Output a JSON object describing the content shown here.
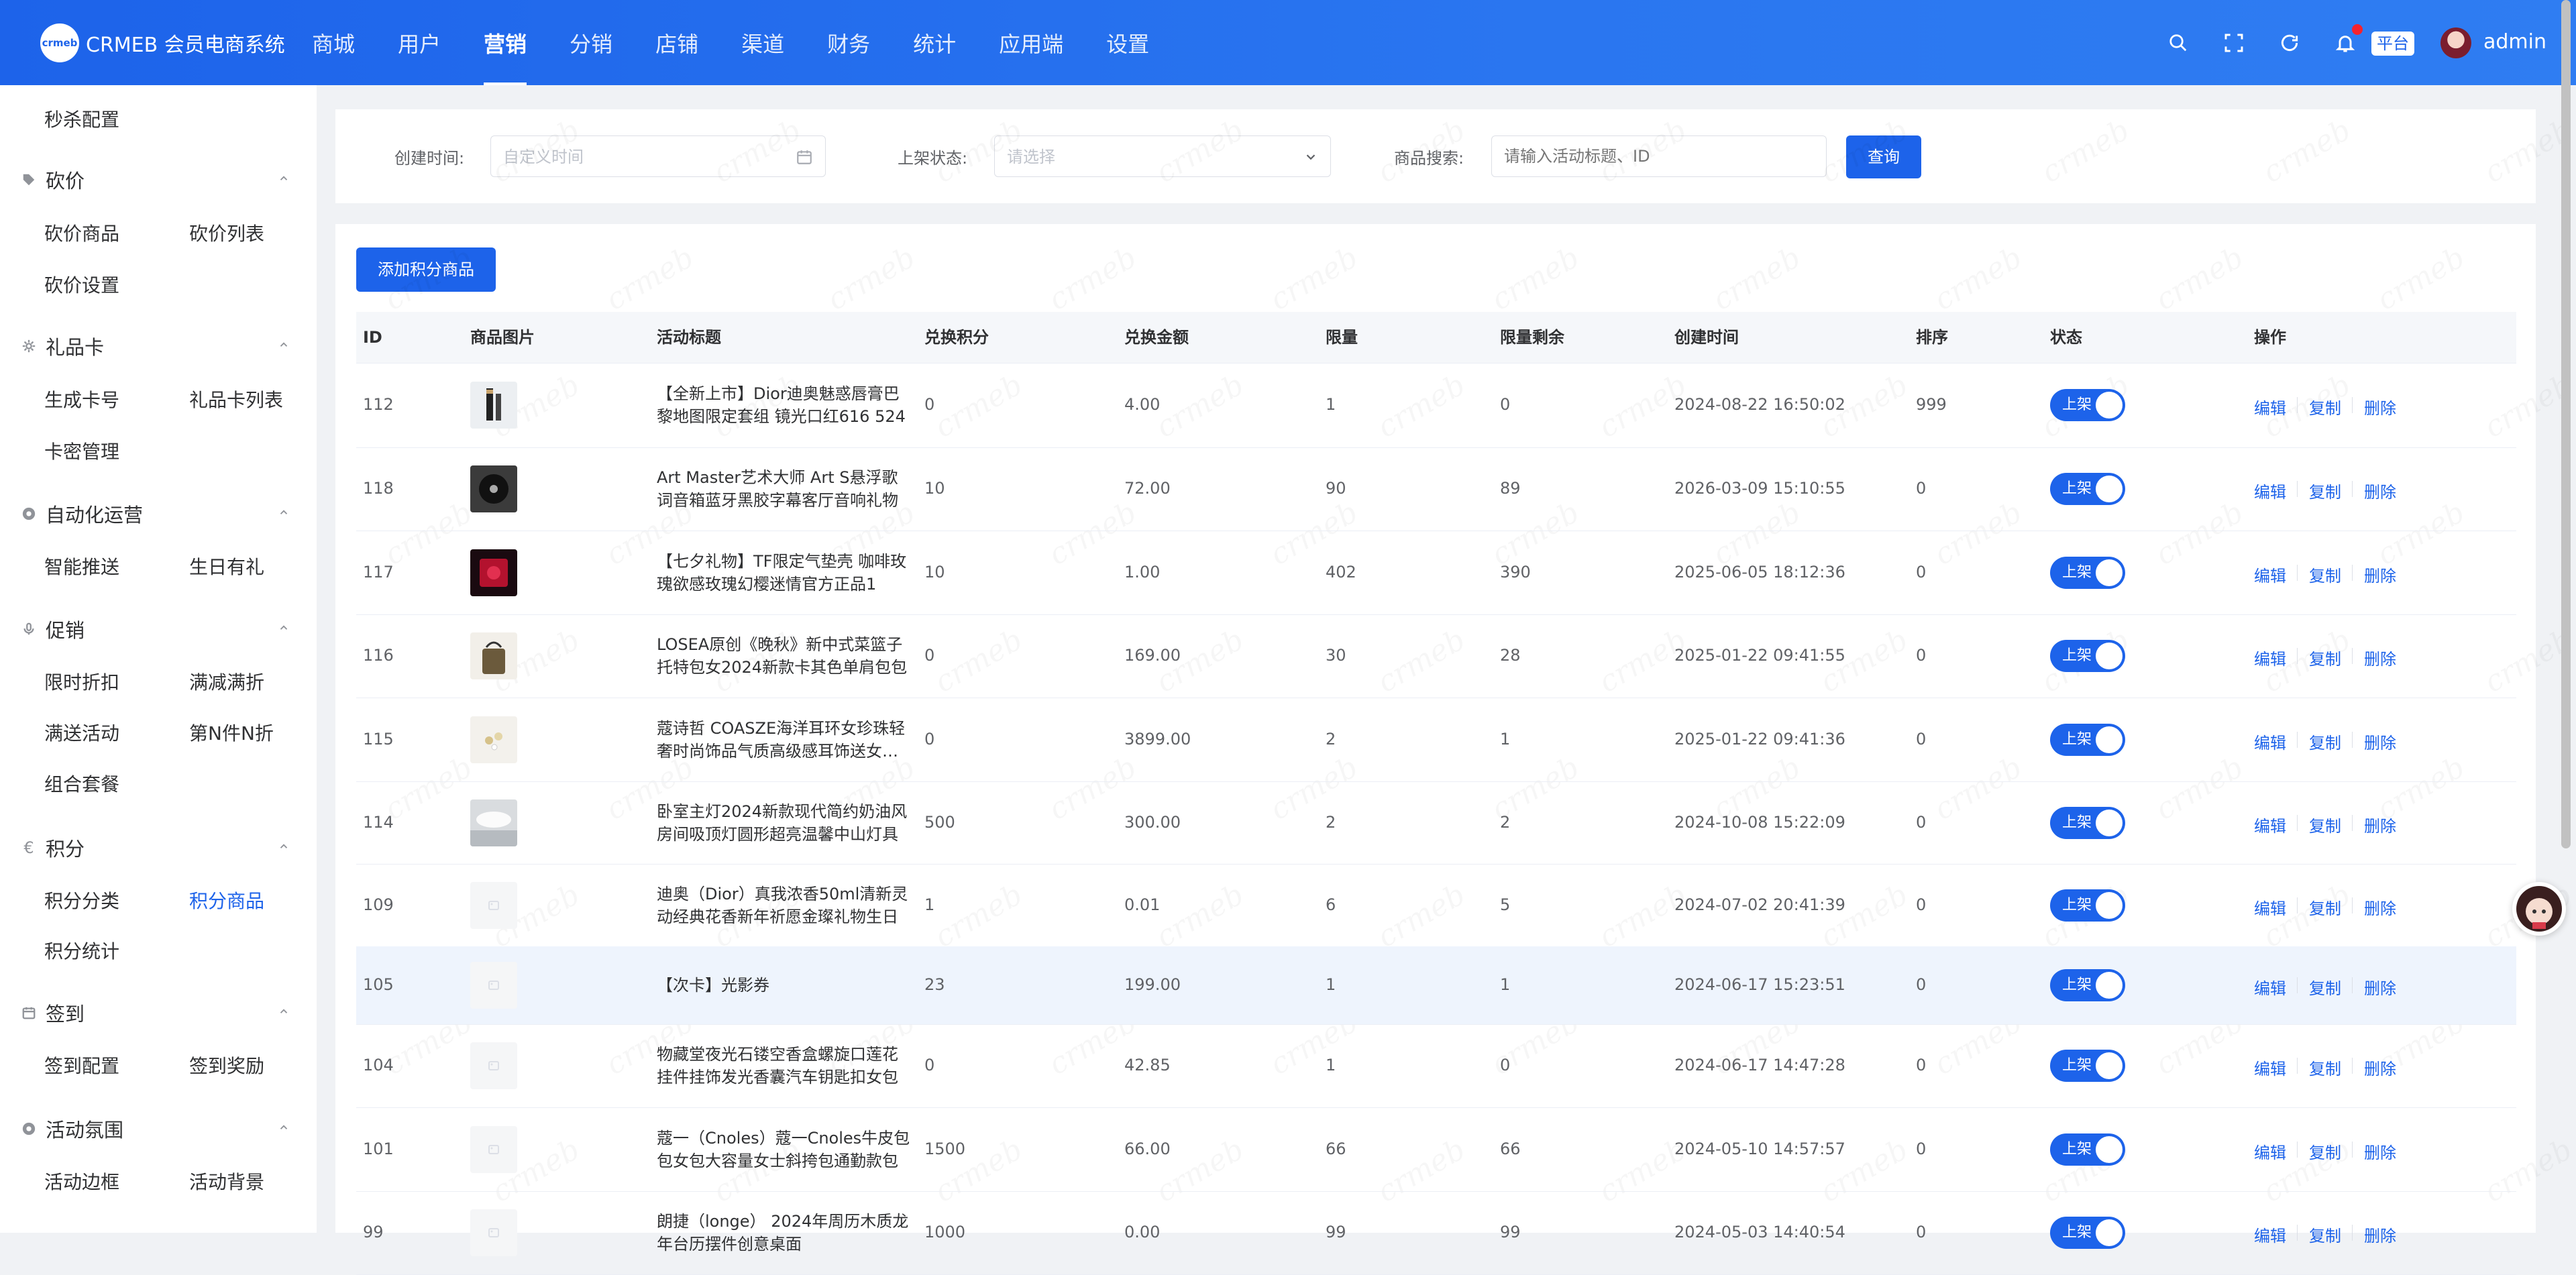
{
  "app": {
    "logo_mark": "crmeb",
    "title": "CRMEB 会员电商系统"
  },
  "topnav": [
    "商城",
    "用户",
    "营销",
    "分销",
    "店铺",
    "渠道",
    "财务",
    "统计",
    "应用端",
    "设置"
  ],
  "header": {
    "platform": "平台",
    "user": "admin"
  },
  "sidebar": {
    "top_item": "秒杀配置",
    "bargain": {
      "title": "砍价",
      "items": [
        "砍价商品",
        "砍价列表",
        "砍价设置"
      ]
    },
    "giftcard": {
      "title": "礼品卡",
      "items": [
        "生成卡号",
        "礼品卡列表",
        "卡密管理"
      ]
    },
    "automation": {
      "title": "自动化运营",
      "items": [
        "智能推送",
        "生日有礼"
      ]
    },
    "promo": {
      "title": "促销",
      "items": [
        "限时折扣",
        "满减满折",
        "满送活动",
        "第N件N折",
        "组合套餐"
      ]
    },
    "points": {
      "title": "积分",
      "items": [
        "积分分类",
        "积分商品",
        "积分统计"
      ],
      "active": "积分商品"
    },
    "signin": {
      "title": "签到",
      "items": [
        "签到配置",
        "签到奖励"
      ]
    },
    "ambience": {
      "title": "活动氛围",
      "items": [
        "活动边框",
        "活动背景"
      ]
    }
  },
  "filters": {
    "created_label": "创建时间:",
    "created_placeholder": "自定义时间",
    "status_label": "上架状态:",
    "status_placeholder": "请选择",
    "search_label": "商品搜索:",
    "search_placeholder": "请输入活动标题、ID",
    "query": "查询"
  },
  "add_button": "添加积分商品",
  "table": {
    "headers": [
      "ID",
      "商品图片",
      "活动标题",
      "兑换积分",
      "兑换金额",
      "限量",
      "限量剩余",
      "创建时间",
      "排序",
      "状态",
      "操作"
    ],
    "status_on": "上架",
    "ops": [
      "编辑",
      "复制",
      "删除"
    ],
    "rows": [
      {
        "id": "112",
        "title": "【全新上市】Dior迪奥魅惑唇膏巴黎地图限定套组 镜光口红616 524",
        "points": "0",
        "amount": "4.00",
        "limit": "1",
        "remain": "0",
        "created": "2024-08-22 16:50:02",
        "sort": "999",
        "img": "lipstick"
      },
      {
        "id": "118",
        "title": "Art Master艺术大师 Art S悬浮歌词音箱蓝牙黑胶字幕客厅音响礼物",
        "points": "10",
        "amount": "72.00",
        "limit": "90",
        "remain": "89",
        "created": "2026-03-09 15:10:55",
        "sort": "0",
        "img": "speaker"
      },
      {
        "id": "117",
        "title": "【七夕礼物】TF限定气垫壳 咖啡玫瑰欲感玫瑰幻樱迷情官方正品1",
        "points": "10",
        "amount": "1.00",
        "limit": "402",
        "remain": "390",
        "created": "2025-06-05 18:12:36",
        "sort": "0",
        "img": "cushion"
      },
      {
        "id": "116",
        "title": "LOSEA原创《晚秋》新中式菜篮子托特包女2024新款卡其色单肩包包",
        "points": "0",
        "amount": "169.00",
        "limit": "30",
        "remain": "28",
        "created": "2025-01-22 09:41:55",
        "sort": "0",
        "img": "bag"
      },
      {
        "id": "115",
        "title": "蔻诗哲 COASZE海洋耳环女珍珠轻奢时尚饰品气质高级感耳饰送女朋友",
        "points": "0",
        "amount": "3899.00",
        "limit": "2",
        "remain": "1",
        "created": "2025-01-22 09:41:36",
        "sort": "0",
        "img": "earring"
      },
      {
        "id": "114",
        "title": "卧室主灯2024新款现代简约奶油风房间吸顶灯圆形超亮温馨中山灯具",
        "points": "500",
        "amount": "300.00",
        "limit": "2",
        "remain": "2",
        "created": "2024-10-08 15:22:09",
        "sort": "0",
        "img": "lamp"
      },
      {
        "id": "109",
        "title": "迪奥（Dior）真我浓香50ml清新灵动经典花香新年祈愿金璨礼物生日",
        "points": "1",
        "amount": "0.01",
        "limit": "6",
        "remain": "5",
        "created": "2024-07-02 20:41:39",
        "sort": "0",
        "img": "placeholder"
      },
      {
        "id": "105",
        "title": "【次卡】光影券",
        "points": "23",
        "amount": "199.00",
        "limit": "1",
        "remain": "1",
        "created": "2024-06-17 15:23:51",
        "sort": "0",
        "img": "placeholder"
      },
      {
        "id": "104",
        "title": "物藏堂夜光石镂空香盒螺旋口莲花挂件挂饰发光香囊汽车钥匙扣女包",
        "points": "0",
        "amount": "42.85",
        "limit": "1",
        "remain": "0",
        "created": "2024-06-17 14:47:28",
        "sort": "0",
        "img": "placeholder"
      },
      {
        "id": "101",
        "title": "蔻一（Cnoles）蔻一Cnoles牛皮包包女包大容量女士斜挎包通勤款包",
        "points": "1500",
        "amount": "66.00",
        "limit": "66",
        "remain": "66",
        "created": "2024-05-10 14:57:57",
        "sort": "0",
        "img": "placeholder"
      },
      {
        "id": "99",
        "title": "朗捷（longe） 2024年周历木质龙年台历摆件创意桌面",
        "points": "1000",
        "amount": "0.00",
        "limit": "99",
        "remain": "99",
        "created": "2024-05-03 14:40:54",
        "sort": "0",
        "img": "placeholder"
      }
    ]
  },
  "watermark_text": "crmeb"
}
